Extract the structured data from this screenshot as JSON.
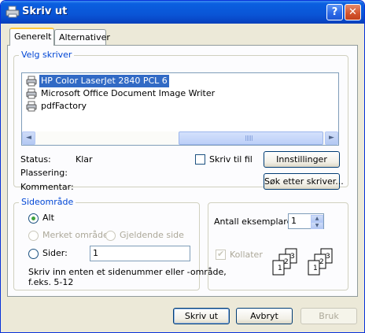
{
  "window": {
    "title": "Skriv ut",
    "help_glyph": "?",
    "close_glyph": "✕"
  },
  "tabs": [
    {
      "label": "Generelt",
      "active": true
    },
    {
      "label": "Alternativer",
      "active": false
    }
  ],
  "select_printer": {
    "group_label": "Velg skriver",
    "printers": [
      {
        "name": "HP Color LaserJet 2840 PCL 6",
        "selected": true
      },
      {
        "name": "Microsoft Office Document Image Writer",
        "selected": false
      },
      {
        "name": "pdfFactory",
        "selected": false
      }
    ],
    "scroll_left": "◄",
    "scroll_right": "►"
  },
  "printer_info": {
    "status_label": "Status:",
    "status_value": "Klar",
    "location_label": "Plassering:",
    "location_value": "",
    "comment_label": "Kommentar:",
    "comment_value": ""
  },
  "print_to_file": {
    "label": "Skriv til fil",
    "checked": false
  },
  "buttons": {
    "preferences": "Innstillinger",
    "find_printer": "Søk etter skriver...",
    "print": "Skriv ut",
    "cancel": "Avbryt",
    "apply": "Bruk"
  },
  "page_range": {
    "group_label": "Sideområde",
    "all": "Alt",
    "selection": "Merket område",
    "current_page": "Gjeldende side",
    "pages": "Sider:",
    "pages_value": "1",
    "hint_line1": "Skriv inn enten et sidenummer eller -område,",
    "hint_line2": "f.eks. 5-12",
    "selected_option": "all"
  },
  "copies": {
    "label": "Antall eksemplarer:",
    "value": "1",
    "collate_label": "Kollater",
    "collate_checked": true,
    "collate_enabled": false,
    "page_numbers": [
      "1",
      "2",
      "3"
    ]
  }
}
